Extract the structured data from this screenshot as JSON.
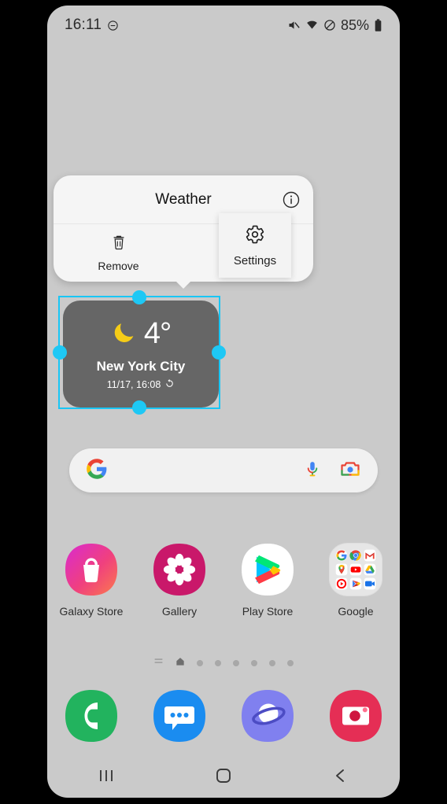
{
  "status_bar": {
    "clock": "16:11",
    "battery_percent": "85%",
    "icons": [
      "do-not-disturb-icon",
      "mute-icon",
      "wifi-icon",
      "block-icon",
      "battery-icon"
    ]
  },
  "widget_popup": {
    "title": "Weather",
    "info_icon": "info-icon",
    "actions": [
      {
        "label": "Remove",
        "icon": "trash-icon"
      },
      {
        "label": "Settings",
        "icon": "gear-icon",
        "pressed": true
      }
    ]
  },
  "weather_widget": {
    "condition_icon": "moon-icon",
    "temperature": "4°",
    "city": "New York City",
    "updated": "11/17, 16:08",
    "refresh_icon": "refresh-icon",
    "selected": true,
    "handle_color": "#1ec8f5",
    "card_color": "#666666"
  },
  "search": {
    "placeholder": "",
    "value": "",
    "google_icon": "google-g-icon",
    "mic_icon": "microphone-icon",
    "lens_icon": "google-lens-icon"
  },
  "apps": [
    {
      "label": "Galaxy Store",
      "icon": "galaxy-store-icon"
    },
    {
      "label": "Gallery",
      "icon": "gallery-icon"
    },
    {
      "label": "Play Store",
      "icon": "play-store-icon"
    },
    {
      "label": "Google",
      "icon": "google-folder-icon"
    }
  ],
  "google_folder_apps": [
    "google-search-icon",
    "chrome-icon",
    "gmail-icon",
    "maps-icon",
    "youtube-icon",
    "drive-icon",
    "youtube-music-icon",
    "google-tv-icon",
    "meet-icon"
  ],
  "page_indicator": {
    "items": [
      "list-icon",
      "home-icon",
      "dot",
      "dot",
      "dot",
      "dot",
      "dot",
      "dot"
    ],
    "active_index": 1
  },
  "dock": [
    {
      "label": "Phone",
      "icon": "phone-icon",
      "color": "#22b35e"
    },
    {
      "label": "Messages",
      "icon": "messages-icon",
      "color": "#1a8cf0"
    },
    {
      "label": "Internet",
      "icon": "internet-icon",
      "color": "#8080ef"
    },
    {
      "label": "Camera",
      "icon": "camera-icon",
      "color": "#e52e55"
    }
  ],
  "nav_bar": {
    "recents_label": "Recents",
    "home_label": "Home",
    "back_label": "Back"
  }
}
